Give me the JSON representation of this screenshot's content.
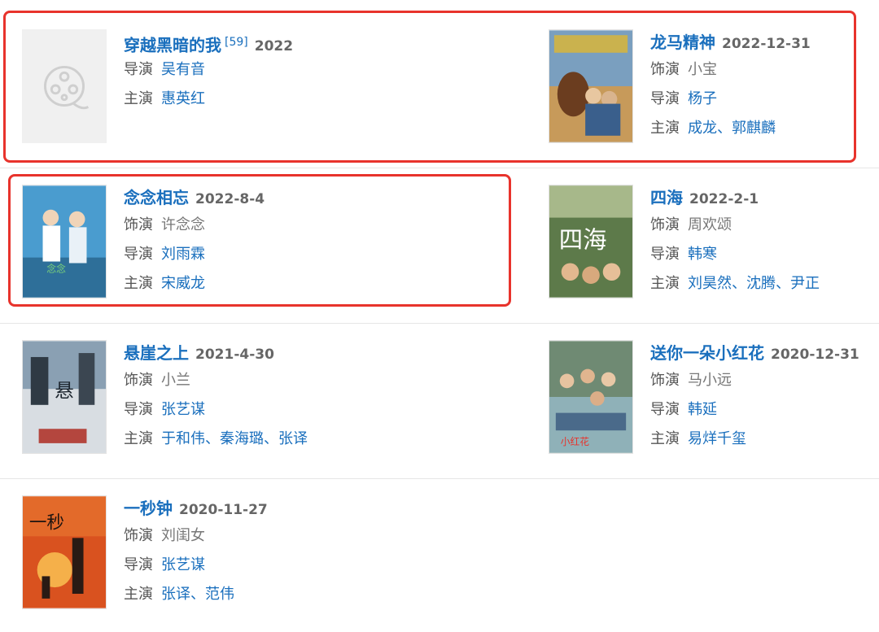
{
  "labels": {
    "role": "饰演",
    "director": "导演",
    "cast": "主演"
  },
  "movies": [
    {
      "title": "穿越黑暗的我",
      "ref": "[59]",
      "date": "2022",
      "director": [
        "吴有音"
      ],
      "cast": [
        "惠英红"
      ]
    },
    {
      "title": "龙马精神",
      "date": "2022-12-31",
      "role": "小宝",
      "director": [
        "杨子"
      ],
      "cast": [
        "成龙",
        "郭麒麟"
      ]
    },
    {
      "title": "念念相忘",
      "date": "2022-8-4",
      "role": "许念念",
      "director": [
        "刘雨霖"
      ],
      "cast": [
        "宋威龙"
      ]
    },
    {
      "title": "四海",
      "date": "2022-2-1",
      "role": "周欢颂",
      "director": [
        "韩寒"
      ],
      "cast": [
        "刘昊然",
        "沈腾",
        "尹正"
      ]
    },
    {
      "title": "悬崖之上",
      "date": "2021-4-30",
      "role": "小兰",
      "director": [
        "张艺谋"
      ],
      "cast": [
        "于和伟",
        "秦海璐",
        "张译"
      ]
    },
    {
      "title": "送你一朵小红花",
      "date": "2020-12-31",
      "role": "马小远",
      "director": [
        "韩延"
      ],
      "cast": [
        "易烊千玺"
      ]
    },
    {
      "title": "一秒钟",
      "date": "2020-11-27",
      "role": "刘闺女",
      "director": [
        "张艺谋"
      ],
      "cast": [
        "张译",
        "范伟"
      ]
    }
  ],
  "colors": {
    "link": "#1a6fbd",
    "highlight": "#e8332c"
  }
}
